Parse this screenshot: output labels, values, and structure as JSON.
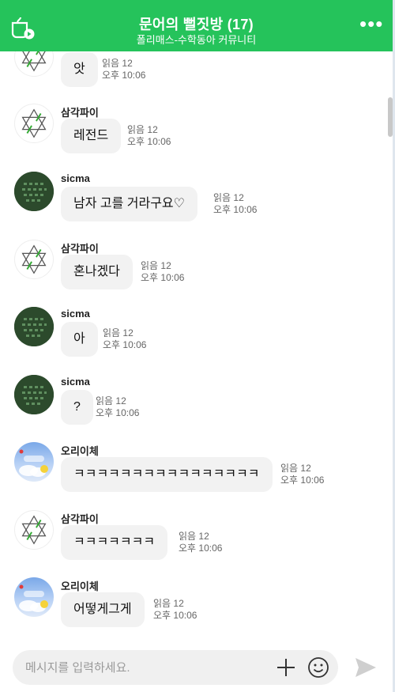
{
  "header": {
    "title": "문어의 뻘짓방 (17)",
    "subtitle": "폴리매스-수학동아 커뮤니티",
    "more_label": "•••"
  },
  "messages": [
    {
      "sender": "",
      "avatar": "star-of-david",
      "text": "앗",
      "read": "읽음 12",
      "time": "오후 10:06"
    },
    {
      "sender": "삼각파이",
      "avatar": "star-of-david",
      "text": "레전드",
      "read": "읽음 12",
      "time": "오후 10:06"
    },
    {
      "sender": "sicma",
      "avatar": "matrix",
      "text": "남자 고를 거라구요♡",
      "read": "읽음 12",
      "time": "오후 10:06"
    },
    {
      "sender": "삼각파이",
      "avatar": "star-of-david",
      "text": "혼나겠다",
      "read": "읽음 12",
      "time": "오후 10:06"
    },
    {
      "sender": "sicma",
      "avatar": "matrix",
      "text": "아",
      "read": "읽음 12",
      "time": "오후 10:06"
    },
    {
      "sender": "sicma",
      "avatar": "matrix",
      "text": "?",
      "read": "읽음 12",
      "time": "오후 10:06"
    },
    {
      "sender": "오리이체",
      "avatar": "duck",
      "text": "ㅋㅋㅋㅋㅋㅋㅋㅋㅋㅋㅋㅋㅋㅋㅋㅋ",
      "read": "읽음 12",
      "time": "오후 10:06"
    },
    {
      "sender": "삼각파이",
      "avatar": "star-of-david",
      "text": "ㅋㅋㅋㅋㅋㅋㅋ",
      "read": "읽음 12",
      "time": "오후 10:06"
    },
    {
      "sender": "오리이체",
      "avatar": "duck",
      "text": "어떻게그게",
      "read": "읽음 12",
      "time": "오후 10:06"
    }
  ],
  "input": {
    "placeholder": "메시지를 입력하세요."
  },
  "icons": {
    "header_left": "chat-cup-icon",
    "more": "more-options-icon",
    "plus": "plus-icon",
    "emoji": "emoji-icon",
    "send": "send-icon"
  },
  "colors": {
    "header": "#25c35b",
    "bubble": "#f2f2f2",
    "input_bg": "#f0f0f0"
  }
}
